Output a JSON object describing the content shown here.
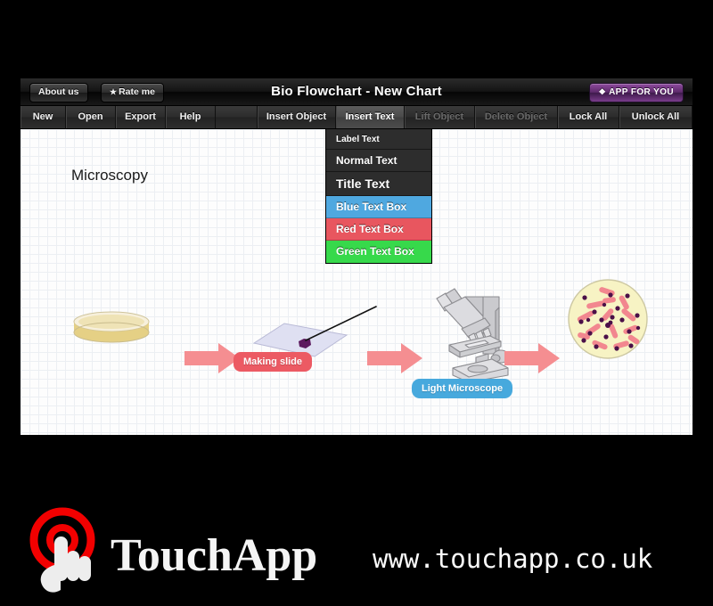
{
  "window": {
    "title": "Bio Flowchart - New Chart",
    "buttons": {
      "about": "About us",
      "rate": "Rate me",
      "rate_icon": "star-icon",
      "app_for_you": "APP FOR YOU",
      "app_for_you_icon": "diamond-icon"
    }
  },
  "menubar": {
    "items": [
      {
        "label": "New",
        "state": "enabled"
      },
      {
        "label": "Open",
        "state": "enabled"
      },
      {
        "label": "Export",
        "state": "enabled"
      },
      {
        "label": "Help",
        "state": "enabled"
      },
      {
        "label": "Insert Object",
        "state": "enabled"
      },
      {
        "label": "Insert Text",
        "state": "active"
      },
      {
        "label": "Lift Object",
        "state": "disabled"
      },
      {
        "label": "Delete Object",
        "state": "disabled"
      },
      {
        "label": "Lock All",
        "state": "enabled"
      },
      {
        "label": "Unlock All",
        "state": "enabled"
      }
    ]
  },
  "dropdown": {
    "open_for": "Insert Text",
    "items": [
      {
        "label": "Label Text",
        "bg": "#2d2d2d",
        "fg": "#ffffff"
      },
      {
        "label": "Normal Text",
        "bg": "#2d2d2d",
        "fg": "#ffffff"
      },
      {
        "label": "Title Text",
        "bg": "#2d2d2d",
        "fg": "#ffffff"
      },
      {
        "label": "Blue Text Box",
        "bg": "#4fa8e0",
        "fg": "#ffffff"
      },
      {
        "label": "Red Text Box",
        "bg": "#e8565f",
        "fg": "#ffffff"
      },
      {
        "label": "Green Text Box",
        "bg": "#37d94b",
        "fg": "#ffffff"
      }
    ]
  },
  "canvas": {
    "title_label": "Microscopy",
    "badges": [
      {
        "text": "Making slide",
        "color": "#ec5a63"
      },
      {
        "text": "Light Microscope",
        "color": "#47a9dd"
      }
    ],
    "objects": [
      {
        "name": "petri-dish",
        "kind": "illustration"
      },
      {
        "name": "arrow-1",
        "kind": "arrow",
        "color": "#f58e91"
      },
      {
        "name": "microscope-slide",
        "kind": "illustration"
      },
      {
        "name": "arrow-2",
        "kind": "arrow",
        "color": "#f58e91"
      },
      {
        "name": "light-microscope",
        "kind": "illustration"
      },
      {
        "name": "arrow-3",
        "kind": "arrow",
        "color": "#f58e91"
      },
      {
        "name": "bacteria-field",
        "kind": "illustration"
      }
    ]
  },
  "footer": {
    "brand": "TouchApp",
    "url": "www.touchapp.co.uk",
    "logo_icon": "touch-ripple-hand-icon",
    "logo_color": "#f20000"
  }
}
